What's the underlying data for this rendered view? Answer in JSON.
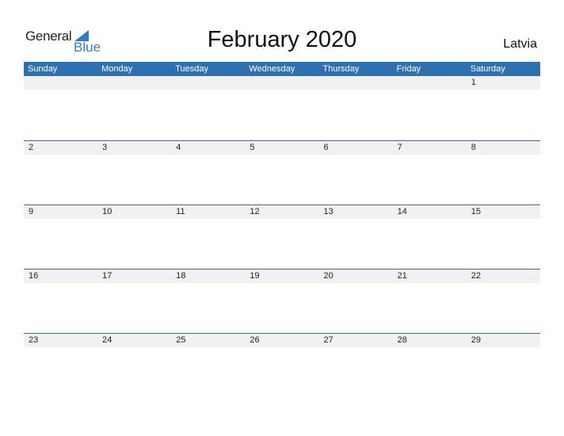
{
  "logo": {
    "part1": "General",
    "part2": "Blue"
  },
  "title": "February 2020",
  "country": "Latvia",
  "weekdays": [
    "Sunday",
    "Monday",
    "Tuesday",
    "Wednesday",
    "Thursday",
    "Friday",
    "Saturday"
  ],
  "weeks": [
    [
      "",
      "",
      "",
      "",
      "",
      "",
      "1"
    ],
    [
      "2",
      "3",
      "4",
      "5",
      "6",
      "7",
      "8"
    ],
    [
      "9",
      "10",
      "11",
      "12",
      "13",
      "14",
      "15"
    ],
    [
      "16",
      "17",
      "18",
      "19",
      "20",
      "21",
      "22"
    ],
    [
      "23",
      "24",
      "25",
      "26",
      "27",
      "28",
      "29"
    ]
  ],
  "colors": {
    "accent": "#2f70b0",
    "logo_blue": "#2f7ec2",
    "date_strip": "#f1f1f1"
  }
}
